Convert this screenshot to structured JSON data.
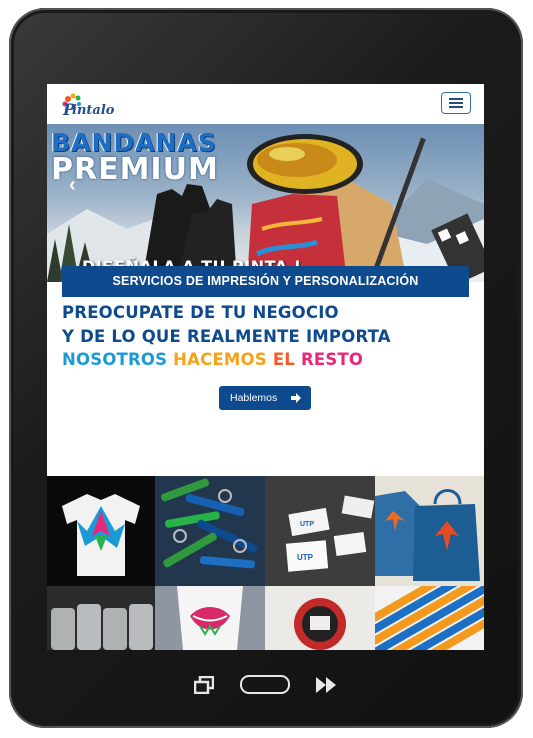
{
  "header": {
    "logo_text": "PINTALO",
    "menu_icon": "hamburger-icon"
  },
  "hero": {
    "title_line1": "BANDANAS",
    "title_line2": "PREMIUM",
    "subtitle": "DISEÑALA A TU PINTA !"
  },
  "services": {
    "banner": "SERVICIOS DE IMPRESIÓN Y PERSONALIZACIÓN"
  },
  "tagline": {
    "line1": "PREOCUPATE DE TU NEGOCIO",
    "line2": "Y DE LO QUE REALMENTE IMPORTA",
    "line3_words": [
      "NOSOTROS",
      "HACEMOS",
      "EL",
      "RESTO"
    ]
  },
  "cta": {
    "label": "Hablemos"
  },
  "gallery": {
    "items": [
      "printed-tshirt",
      "keychains",
      "business-cards",
      "tote-bags",
      "glass-jars",
      "lips-tshirt",
      "printed-bag",
      "pencils"
    ]
  },
  "colors": {
    "brand_blue": "#0e4a8e",
    "accent_cyan": "#1c9ad6",
    "accent_green": "#28b24a",
    "accent_orange": "#f7a21b",
    "accent_red": "#f25a24",
    "accent_pink": "#e6287a"
  },
  "device_nav": {
    "recent": "recent-apps-icon",
    "home": "home-button",
    "back": "fast-forward-icon"
  }
}
